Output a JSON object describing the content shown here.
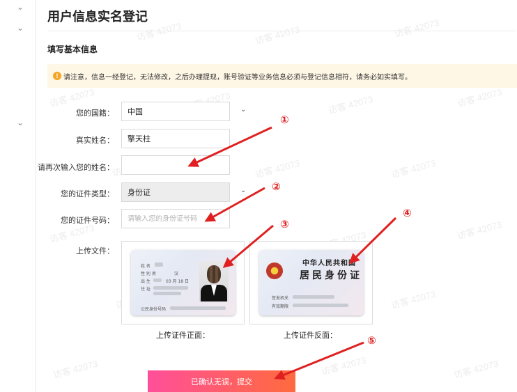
{
  "page": {
    "title": "用户信息实名登记",
    "section_title": "填写基本信息",
    "notice": "请注意，信息一经登记，无法修改，之后办理提现，账号验证等业务信息必须与登记信息相符，请务必如实填写。"
  },
  "form": {
    "nationality": {
      "label": "您的国籍：",
      "value": "中国"
    },
    "real_name": {
      "label": "真实姓名：",
      "value": "擎天柱"
    },
    "confirm_name": {
      "label": "请再次输入您的姓名：",
      "value": ""
    },
    "id_type": {
      "label": "您的证件类型：",
      "value": "身份证"
    },
    "id_number": {
      "label": "您的证件号码：",
      "placeholder": "请输入您的身份证号码"
    },
    "upload": {
      "label": "上传文件：",
      "front_caption": "上传证件正面：",
      "back_caption": "上传证件反面："
    },
    "submit_label": "已确认无误，提交"
  },
  "id_card_front": {
    "field_labels": [
      "姓 名",
      "性 别",
      "出 生",
      "住 址"
    ],
    "gender_value": "男",
    "ethnicity_value": "汉",
    "birth_value": "03 月 18 日",
    "id_label": "公民身份号码"
  },
  "id_card_back": {
    "line1": "中华人民共和国",
    "line2": "居民身份证",
    "issuer_label": "签发机关",
    "validity_label": "有效期限"
  },
  "annotations": [
    "①",
    "②",
    "③",
    "④",
    "⑤"
  ],
  "watermark": "访客 42073",
  "colors": {
    "arrow": "#e02020",
    "submit_start": "#ff4f9a",
    "submit_end": "#ff6b3d",
    "notice_bg": "#fff7e6",
    "notice_icon": "#f5a623"
  }
}
